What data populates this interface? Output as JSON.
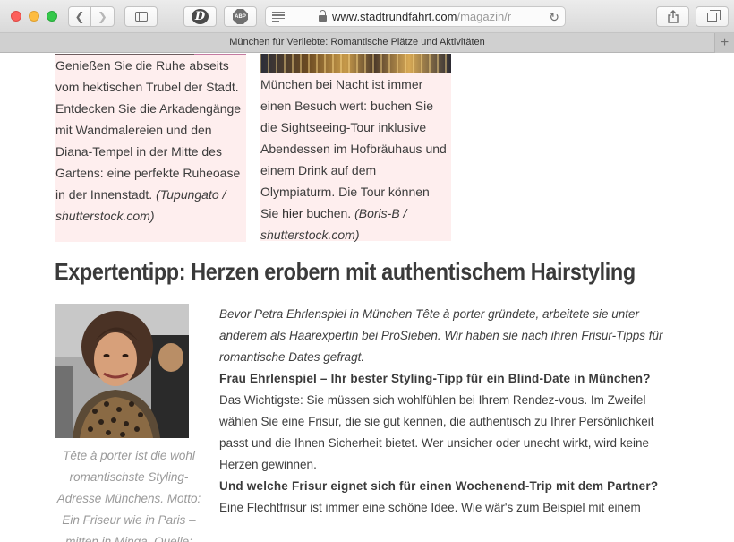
{
  "browser": {
    "url_host": "www.stadtrundfahrt.com",
    "url_rest": "/magazin/m",
    "tab_title": "München für Verliebte: Romantische Plätze und Aktivitäten",
    "ext1_label": "D",
    "ext2_label": "ABP",
    "new_tab": "+"
  },
  "cards": {
    "left": {
      "text": "Genießen Sie die Ruhe abseits vom hektischen Trubel der Stadt. Entdecken Sie die Arkadengänge mit Wandmalereien und den Diana-Tempel in der Mitte des Gartens: eine perfekte Ruheoase in der Innenstadt. ",
      "credit": "(Tupungato / shutterstock.com)"
    },
    "right": {
      "text_before": "München bei Nacht ist immer einen Besuch wert: buchen Sie die Sightseeing-Tour inklusive Abendessen im Hofbräuhaus und einem Drink auf dem Olympiaturm. Die Tour können Sie ",
      "link": "hier",
      "text_after": " buchen. ",
      "credit": "(Boris-B / shutterstock.com)"
    }
  },
  "section": {
    "heading": "Expertentipp: Herzen erobern mit authentischem Hairstyling",
    "caption": "Tête à porter ist die wohl romantischste Styling-Adresse Münchens. Motto: Ein Friseur wie in Paris – mitten in Minga. Quelle:",
    "intro": "Bevor Petra Ehrlenspiel in München Tête à porter gründete, arbeitete sie unter anderem als Haarexpertin bei ProSieben. Wir haben sie nach ihren Frisur-Tipps für romantische Dates gefragt.",
    "q1": "Frau Ehrlenspiel – Ihr bester Styling-Tipp für ein Blind-Date in München?",
    "a1": "Das Wichtigste: Sie müssen sich wohlfühlen bei Ihrem Rendez-vous. Im Zweifel wählen Sie eine Frisur, die sie gut kennen, die authentisch zu Ihrer Persönlichkeit passt und die Ihnen Sicherheit bietet. Wer unsicher oder unecht wirkt, wird keine Herzen gewinnen.",
    "q2": "Und welche Frisur eignet sich für einen Wochenend-Trip mit dem Partner?",
    "a2": "Eine Flechtfrisur ist immer eine schöne Idee. Wie wär's zum Beispiel mit einem"
  }
}
